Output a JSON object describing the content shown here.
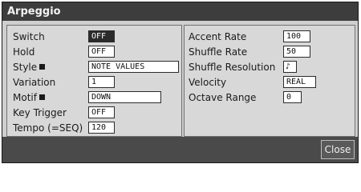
{
  "dialog": {
    "title": "Arpeggio",
    "close_label": "Close"
  },
  "left": {
    "switch": {
      "label": "Switch",
      "value": "OFF"
    },
    "hold": {
      "label": "Hold",
      "value": "OFF"
    },
    "style": {
      "label": "Style",
      "value": "NOTE VALUES"
    },
    "variation": {
      "label": "Variation",
      "value": "1"
    },
    "motif": {
      "label": "Motif",
      "value": "DOWN"
    },
    "key_trigger": {
      "label": "Key Trigger",
      "value": "OFF"
    },
    "tempo": {
      "label": "Tempo (=SEQ)",
      "value": "120"
    }
  },
  "right": {
    "accent_rate": {
      "label": "Accent Rate",
      "value": "100"
    },
    "shuffle_rate": {
      "label": "Shuffle Rate",
      "value": "50"
    },
    "shuffle_resolution": {
      "label": "Shuffle Resolution",
      "value": "♪"
    },
    "velocity": {
      "label": "Velocity",
      "value": "REAL"
    },
    "octave_range": {
      "label": "Octave Range",
      "value": "0"
    }
  }
}
